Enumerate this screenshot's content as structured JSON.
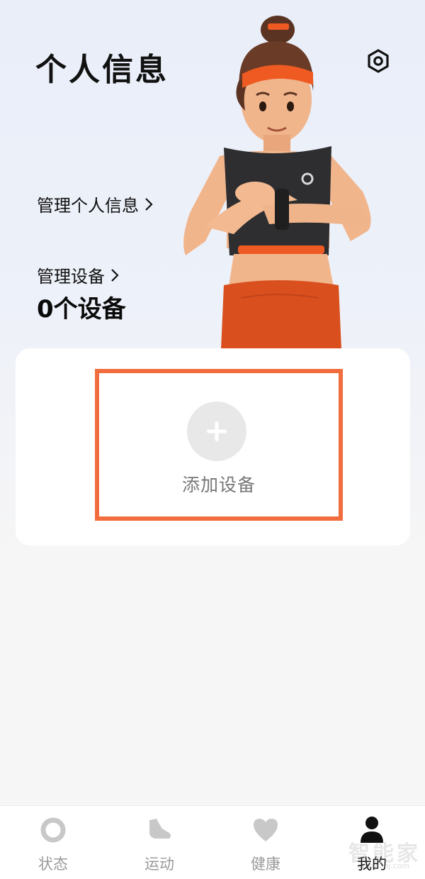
{
  "header": {
    "title": "个人信息",
    "settings_icon": "gear-icon"
  },
  "profile": {
    "manage_profile_label": "管理个人信息",
    "manage_devices_label": "管理设备",
    "device_count_label": "0个设备"
  },
  "add_device": {
    "label": "添加设备",
    "icon": "plus-icon"
  },
  "bottom_nav": {
    "items": [
      {
        "label": "状态",
        "icon": "ring-icon",
        "active": false
      },
      {
        "label": "运动",
        "icon": "shoe-icon",
        "active": false
      },
      {
        "label": "健康",
        "icon": "heart-icon",
        "active": false
      },
      {
        "label": "我的",
        "icon": "person-icon",
        "active": true
      }
    ]
  },
  "watermark": {
    "text": "智能家",
    "url": "www.znj.com"
  },
  "colors": {
    "accent": "#f26d3d",
    "nav_inactive": "#c8c8c8",
    "nav_active": "#111111"
  }
}
